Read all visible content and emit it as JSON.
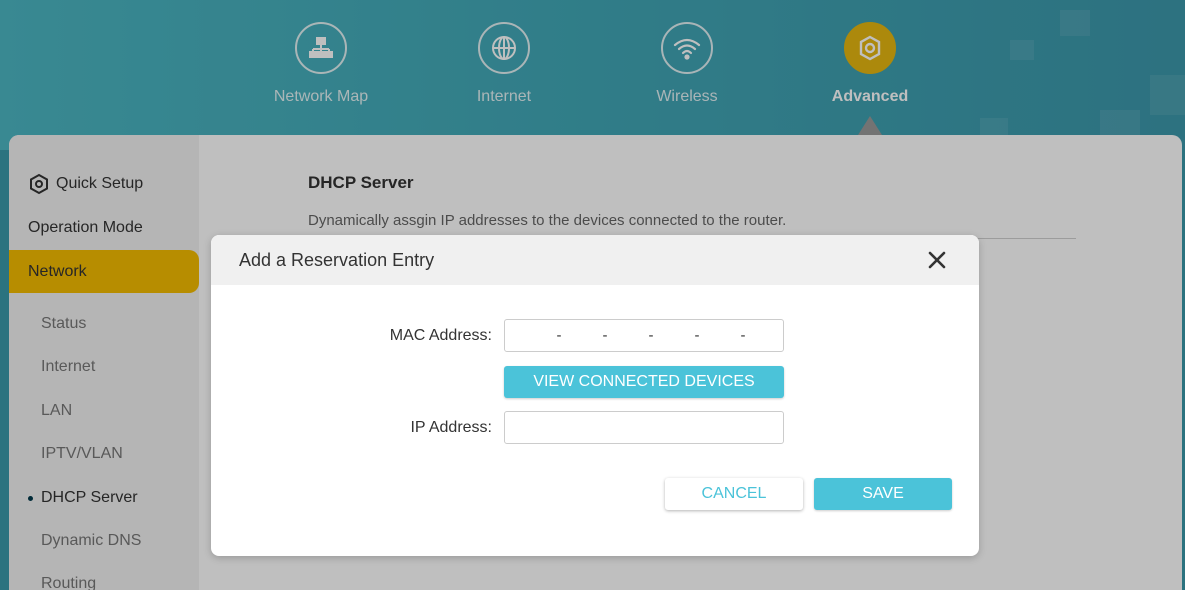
{
  "nav": {
    "items": [
      {
        "label": "Network Map",
        "icon": "network-map-icon"
      },
      {
        "label": "Internet",
        "icon": "globe-icon"
      },
      {
        "label": "Wireless",
        "icon": "wifi-icon"
      },
      {
        "label": "Advanced",
        "icon": "gear-icon",
        "active": true
      }
    ],
    "accent": "#e6b711"
  },
  "sidebar": {
    "top": [
      {
        "label": "Quick Setup",
        "icon": "gear-icon"
      },
      {
        "label": "Operation Mode"
      },
      {
        "label": "Network",
        "selected": true
      }
    ],
    "sub": [
      "Status",
      "Internet",
      "LAN",
      "IPTV/VLAN",
      "DHCP Server",
      "Dynamic DNS",
      "Routing"
    ],
    "current": "DHCP Server",
    "highlight": "#f5bc00"
  },
  "content": {
    "title": "DHCP Server",
    "description": "Dynamically assgin IP addresses to the devices connected to the router."
  },
  "modal": {
    "title": "Add a Reservation Entry",
    "mac_label": "MAC Address:",
    "mac_separator": "-",
    "view_button": "VIEW CONNECTED DEVICES",
    "ip_label": "IP Address:",
    "ip_value": "",
    "cancel": "CANCEL",
    "save": "SAVE",
    "button_color": "#4bc3d9"
  }
}
